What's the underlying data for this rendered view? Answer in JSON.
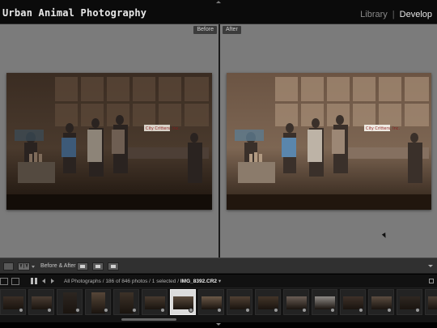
{
  "identity_plate": "Urban Animal Photography",
  "modules": {
    "library": "Library",
    "separator": "|",
    "develop": "Develop"
  },
  "panes": {
    "before_label": "Before",
    "after_label": "After"
  },
  "photo_sign_text": "City Critters, Inc.",
  "toolbar": {
    "view_yy": "Y|Y",
    "before_after_label": "Before & After :"
  },
  "filmstrip": {
    "source": "All Photographs",
    "count_text": "/ 186 of 846 photos / 1 selected /",
    "filename": "IMG_8392.CR2",
    "thumbnail_count": 16,
    "selected_index": 6
  },
  "colors": {
    "panel_gray": "#7b7b7b",
    "active_module": "#e6e6e6",
    "inactive_module": "#8a8a8a"
  }
}
